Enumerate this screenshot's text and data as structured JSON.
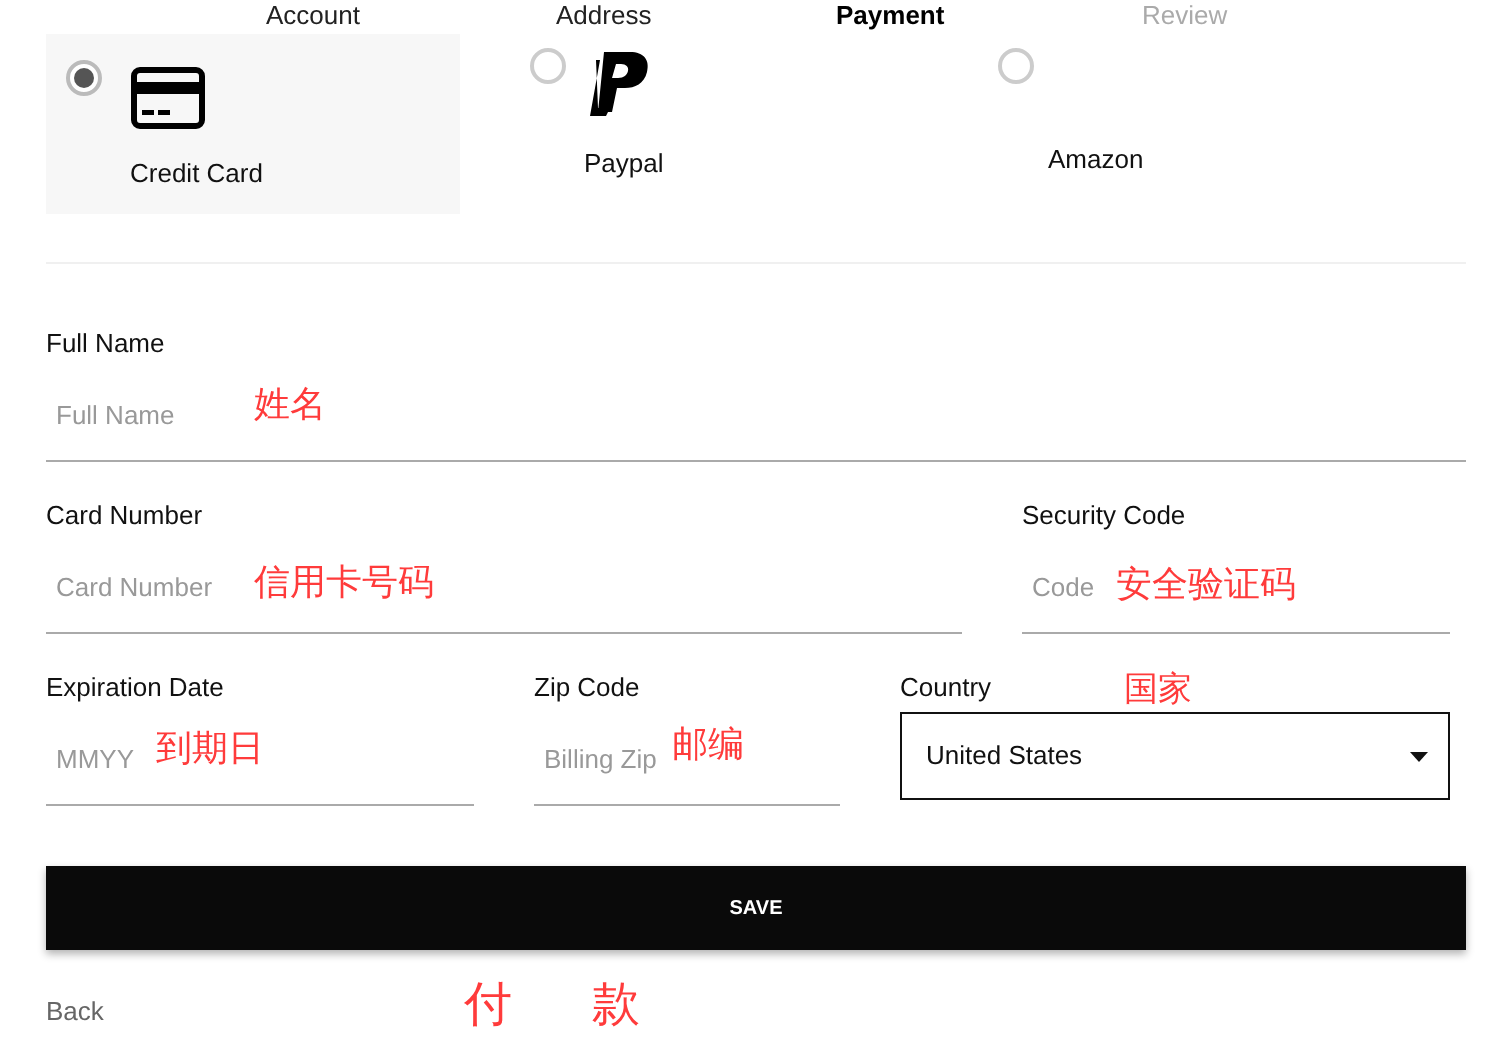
{
  "steps": [
    {
      "label": "Account",
      "selected": false,
      "completed": true
    },
    {
      "label": "Address",
      "selected": false,
      "completed": true
    },
    {
      "label": "Payment",
      "selected": true,
      "completed": false
    },
    {
      "label": "Review",
      "selected": false,
      "completed": false
    }
  ],
  "payment_methods": [
    {
      "kind": "card",
      "label": "Credit Card",
      "selected": true
    },
    {
      "kind": "paypal",
      "label": "Paypal",
      "selected": false
    },
    {
      "kind": "amazon",
      "label": "Amazon",
      "selected": false
    }
  ],
  "form": {
    "full_name": {
      "label": "Full Name",
      "placeholder": "Full Name",
      "note": "姓名"
    },
    "card_number": {
      "label": "Card Number",
      "placeholder": "Card Number",
      "note": "信用卡号码"
    },
    "security_code": {
      "label": "Security Code",
      "placeholder": "Code",
      "note": "安全验证码"
    },
    "expiration_date": {
      "label": "Expiration Date",
      "placeholder": "MMYY",
      "note": "到期日"
    },
    "zip_code": {
      "label": "Zip Code",
      "placeholder": "Billing Zip",
      "note": "邮编"
    },
    "country": {
      "label": "Country",
      "value": "United States",
      "note": "国家"
    }
  },
  "save_button": "SAVE",
  "back_link": "Back",
  "page_note": "付款"
}
